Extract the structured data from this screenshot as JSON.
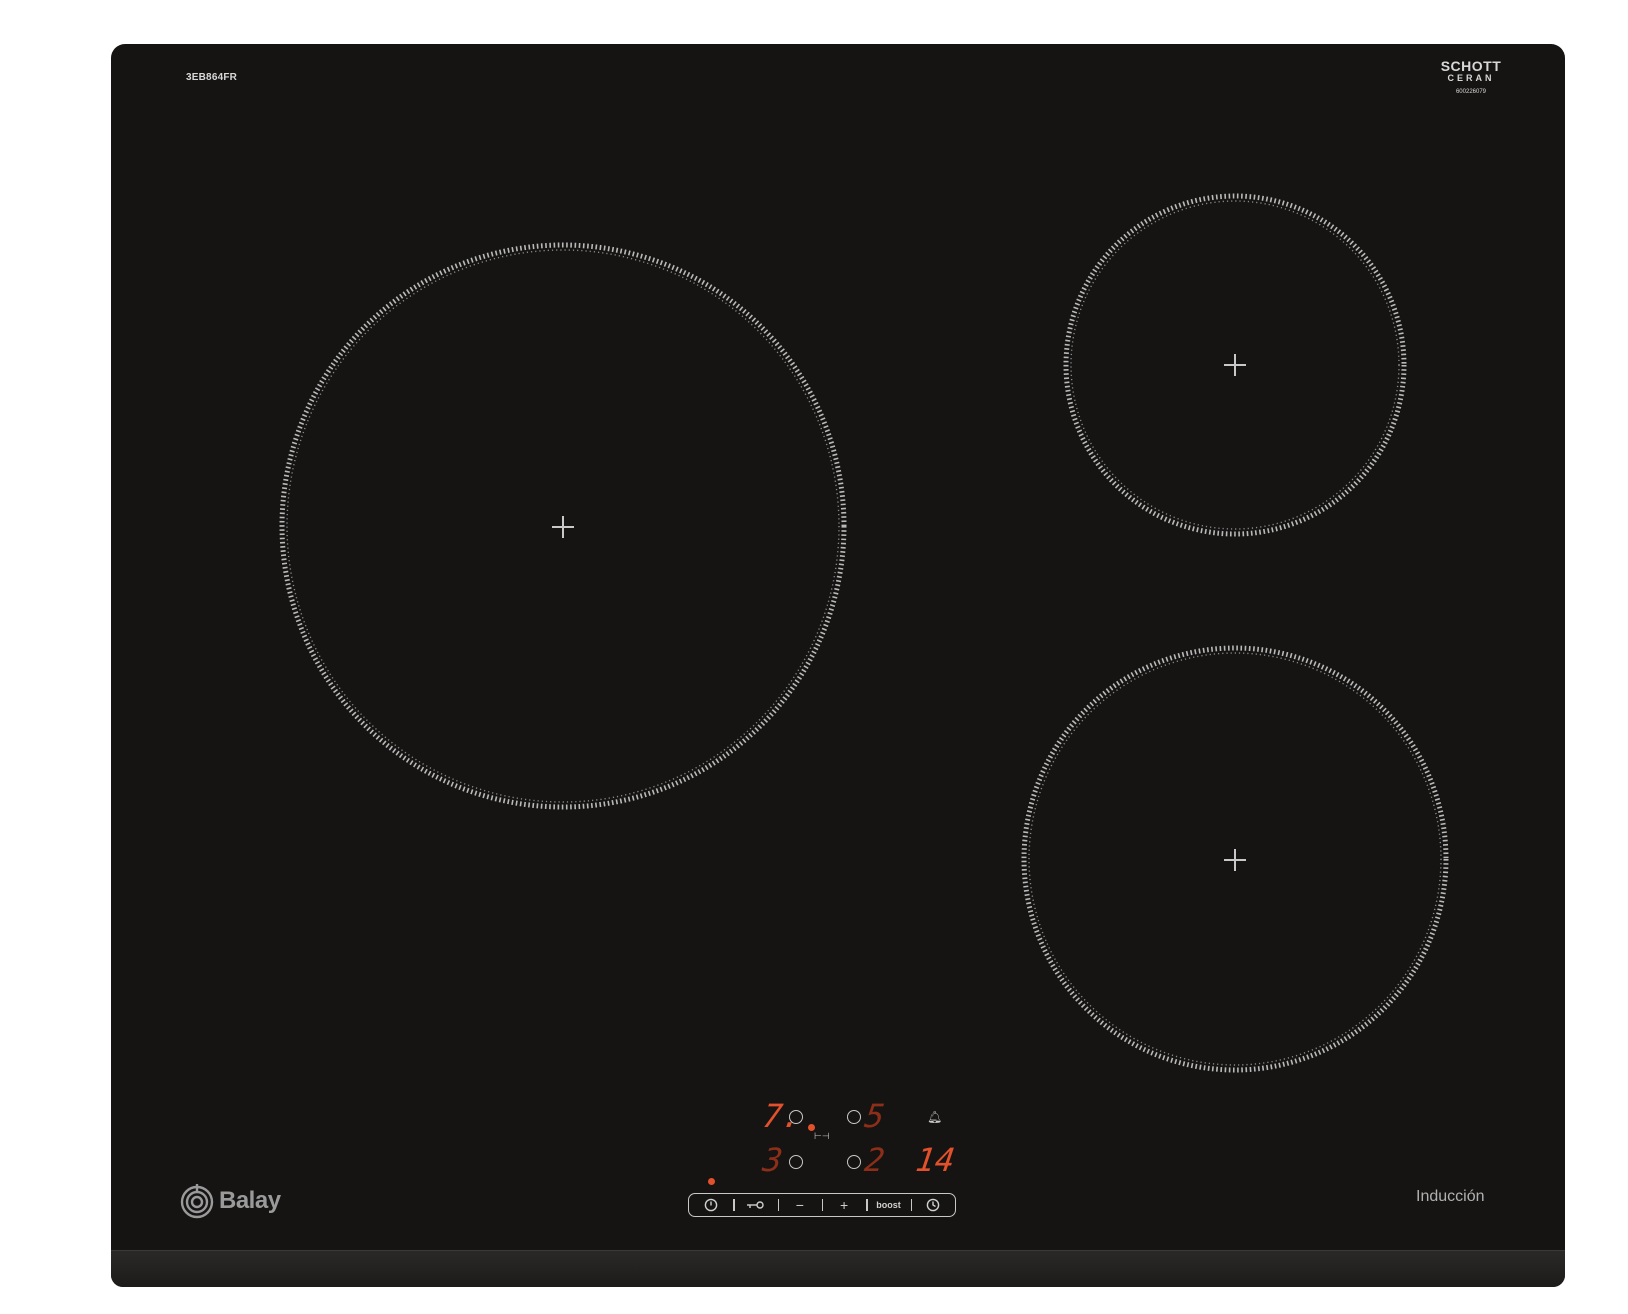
{
  "model_code": "3EB864FR",
  "ceramic_brand": {
    "line1": "SCHOTT",
    "line2": "CERAN",
    "code": "600226079"
  },
  "zones": [
    {
      "name": "large-left"
    },
    {
      "name": "small-top-right"
    },
    {
      "name": "medium-bottom-right"
    }
  ],
  "display": {
    "top_left_level": "7.",
    "top_right_level": "5",
    "bottom_left_level": "3",
    "bottom_right_level": "2",
    "timer": "14"
  },
  "controls": {
    "power_icon": "power-icon",
    "lock_icon": "key-lock-icon",
    "minus": "−",
    "plus": "+",
    "boost": "boost",
    "timer_icon": "clock-icon"
  },
  "brand": "Balay",
  "type_label": "Inducción",
  "colors": {
    "glass": "#151413",
    "display": "#e2512b",
    "print": "#c8c8c8"
  }
}
